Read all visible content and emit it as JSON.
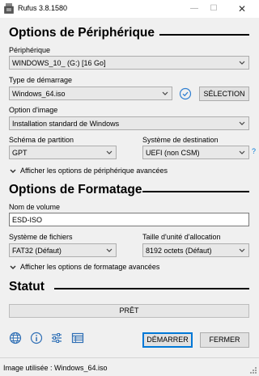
{
  "window": {
    "title": "Rufus 3.8.1580"
  },
  "drive_section": {
    "heading": "Options de Périphérique",
    "device_label": "Périphérique",
    "device_value": "WINDOWS_10_ (G:) [16 Go]",
    "boot_label": "Type de démarrage",
    "boot_value": "Windows_64.iso",
    "select_button": "SÉLECTION",
    "image_label": "Option d'image",
    "image_value": "Installation standard de Windows",
    "partition_label": "Schéma de partition",
    "partition_value": "GPT",
    "target_label": "Système de destination",
    "target_value": "UEFI (non CSM)",
    "help_mark": "?",
    "advanced_toggle": "Afficher les options de périphérique avancées"
  },
  "format_section": {
    "heading": "Options de Formatage",
    "volume_label": "Nom de volume",
    "volume_value": "ESD-ISO",
    "fs_label": "Système de fichiers",
    "fs_value": "FAT32 (Défaut)",
    "cluster_label": "Taille d'unité d'allocation",
    "cluster_value": "8192 octets (Défaut)",
    "advanced_toggle": "Afficher les options de formatage avancées"
  },
  "status_section": {
    "heading": "Statut",
    "status_text": "PRÊT"
  },
  "actions": {
    "start": "DÉMARRER",
    "close": "FERMER"
  },
  "footer": {
    "text": "Image utilisée : Windows_64.iso"
  },
  "colors": {
    "accent": "#0078d7",
    "window_bg": "#f0f0f0",
    "combo_bg": "#e8e8e8",
    "button_bg": "#e1e1e1"
  },
  "icons": [
    "rufus-app-icon",
    "globe-icon",
    "info-icon",
    "settings-sliders-icon",
    "log-icon",
    "check-circle-icon",
    "chevron-down-icon"
  ]
}
